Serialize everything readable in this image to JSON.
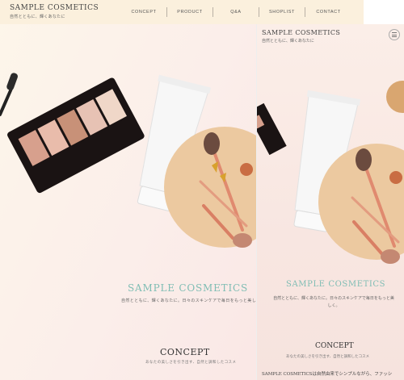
{
  "desktop": {
    "logo": {
      "title": "SAMPLE COSMETICS",
      "subtitle": "自然とともに、輝くあなたに"
    },
    "nav": [
      "CONCEPT",
      "PRODUCT",
      "Q&A",
      "SHOPLIST",
      "CONTACT"
    ],
    "hero": {
      "title": "SAMPLE COSMETICS",
      "subtitle": "自然とともに、輝くあなたに。日々のスキンケアで毎日をもっと美しく。"
    },
    "concept": {
      "title": "CONCEPT",
      "subtitle": "あなたの美しさを引き出す、自然と調和したコスメ"
    }
  },
  "mobile": {
    "logo": {
      "title": "SAMPLE COSMETICS",
      "subtitle": "自然とともに、輝くあなたに"
    },
    "hero": {
      "title": "SAMPLE COSMETICS",
      "subtitle": "自然とともに、輝くあなたに。日々のスキンケアで毎日をもっと美しく。"
    },
    "concept": {
      "title": "CONCEPT",
      "subtitle": "あなたの美しさを引き出す、自然と調和したコスメ",
      "body": "SAMPLE COSMETICSは自然由来でシンプルながら、ファッシ"
    }
  },
  "colors": {
    "accent": "#7fbdb4",
    "header_bg": "#fbf0dd",
    "plate": "#ecc9a0"
  }
}
